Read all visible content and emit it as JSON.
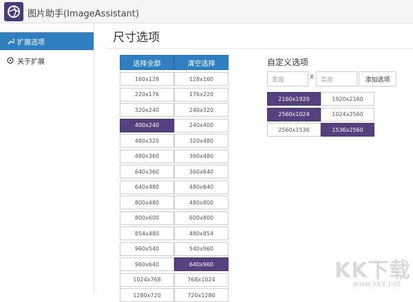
{
  "app": {
    "title": "图片助手(ImageAssistant)"
  },
  "sidebar": {
    "items": [
      {
        "label": "扩展选项",
        "active": true,
        "icon": "wrench-icon"
      },
      {
        "label": "关于扩展",
        "active": false,
        "icon": "info-circle-icon"
      }
    ]
  },
  "main": {
    "title": "尺寸选项",
    "select_all": "选择全部",
    "clear_selection": "清空选择",
    "sizes": [
      {
        "left": "160x128",
        "right": "128x160",
        "left_selected": false,
        "right_selected": false
      },
      {
        "left": "220x176",
        "right": "176x220",
        "left_selected": false,
        "right_selected": false
      },
      {
        "left": "320x240",
        "right": "240x320",
        "left_selected": false,
        "right_selected": false
      },
      {
        "left": "400x240",
        "right": "240x400",
        "left_selected": true,
        "right_selected": false
      },
      {
        "left": "480x320",
        "right": "320x480",
        "left_selected": false,
        "right_selected": false
      },
      {
        "left": "480x360",
        "right": "360x480",
        "left_selected": false,
        "right_selected": false
      },
      {
        "left": "640x360",
        "right": "360x640",
        "left_selected": false,
        "right_selected": false
      },
      {
        "left": "640x480",
        "right": "480x640",
        "left_selected": false,
        "right_selected": false
      },
      {
        "left": "800x480",
        "right": "480x800",
        "left_selected": false,
        "right_selected": false
      },
      {
        "left": "800x600",
        "right": "600x800",
        "left_selected": false,
        "right_selected": false
      },
      {
        "left": "854x480",
        "right": "480x854",
        "left_selected": false,
        "right_selected": false
      },
      {
        "left": "960x540",
        "right": "540x960",
        "left_selected": false,
        "right_selected": false
      },
      {
        "left": "960x640",
        "right": "640x960",
        "left_selected": false,
        "right_selected": true
      },
      {
        "left": "1024x768",
        "right": "768x1024",
        "left_selected": false,
        "right_selected": false
      },
      {
        "left": "1280x720",
        "right": "720x1280",
        "left_selected": false,
        "right_selected": false
      }
    ]
  },
  "custom": {
    "title": "自定义选项",
    "width_placeholder": "宽度",
    "height_placeholder": "高度",
    "separator": "X",
    "add_button": "添加选项",
    "sizes": [
      {
        "left": "2160x1920",
        "right": "1920x2160",
        "left_selected": true,
        "right_selected": false
      },
      {
        "left": "2560x1024",
        "right": "1024x2560",
        "left_selected": true,
        "right_selected": false
      },
      {
        "left": "2560x1536",
        "right": "1536x2560",
        "left_selected": false,
        "right_selected": true
      }
    ]
  },
  "watermark": {
    "text": "KK下载",
    "url": "www.kkx.net"
  },
  "colors": {
    "accent": "#2f7fc1",
    "selected": "#57407e"
  }
}
